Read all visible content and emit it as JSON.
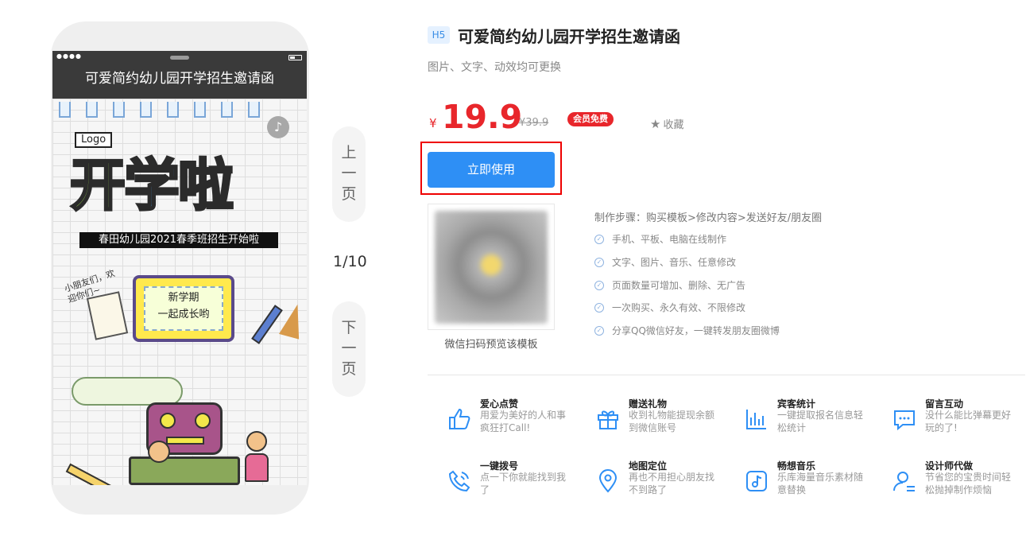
{
  "phone": {
    "title": "可爱简约幼儿园开学招生邀请函",
    "poster": {
      "logo": "Logo",
      "headline": [
        "开",
        "学",
        "啦"
      ],
      "subtitle": "春田幼儿园2021春季班招生开始啦",
      "note_left": "小朋友们，欢迎你们~",
      "sign_line1": "新学期",
      "sign_line2": "一起成长哟"
    }
  },
  "pager": {
    "prev": [
      "上",
      "一",
      "页"
    ],
    "current": "1/10",
    "next": [
      "下",
      "一",
      "页"
    ]
  },
  "product": {
    "badge": "H5",
    "title": "可爱简约幼儿园开学招生邀请函",
    "description": "图片、文字、动效均可更换",
    "currency": "¥",
    "price": "19.9",
    "old_price": "¥39.9",
    "vip_tag": "会员免费",
    "favorite": "收藏",
    "use_button": "立即使用",
    "qr_caption": "微信扫码预览该模板",
    "steps_title": "制作步骤：购买模板>修改内容>发送好友/朋友圈",
    "steps": [
      "手机、平板、电脑在线制作",
      "文字、图片、音乐、任意修改",
      "页面数量可增加、删除、无广告",
      "一次购买、永久有效、不限修改",
      "分享QQ微信好友，一键转发朋友圈微博"
    ]
  },
  "features": [
    {
      "name": "爱心点赞",
      "desc": "用爱为美好的人和事疯狂打Call!",
      "icon": "thumbs-up-icon"
    },
    {
      "name": "赠送礼物",
      "desc": "收到礼物能提现余额到微信账号",
      "icon": "gift-icon"
    },
    {
      "name": "宾客统计",
      "desc": "一键提取报名信息轻松统计",
      "icon": "bar-chart-icon"
    },
    {
      "name": "留言互动",
      "desc": "没什么能比弹幕更好玩的了!",
      "icon": "message-icon"
    },
    {
      "name": "一键拨号",
      "desc": "点一下你就能找到我了",
      "icon": "phone-icon"
    },
    {
      "name": "地图定位",
      "desc": "再也不用担心朋友找不到路了",
      "icon": "map-pin-icon"
    },
    {
      "name": "畅想音乐",
      "desc": "乐库海量音乐素材随意替换",
      "icon": "music-icon"
    },
    {
      "name": "设计师代做",
      "desc": "节省您的宝贵时间轻松抛掉制作烦恼",
      "icon": "designer-icon"
    }
  ],
  "colors": {
    "accent": "#2e8ff5",
    "price": "#e8262b",
    "highlight": "#ee0000"
  }
}
